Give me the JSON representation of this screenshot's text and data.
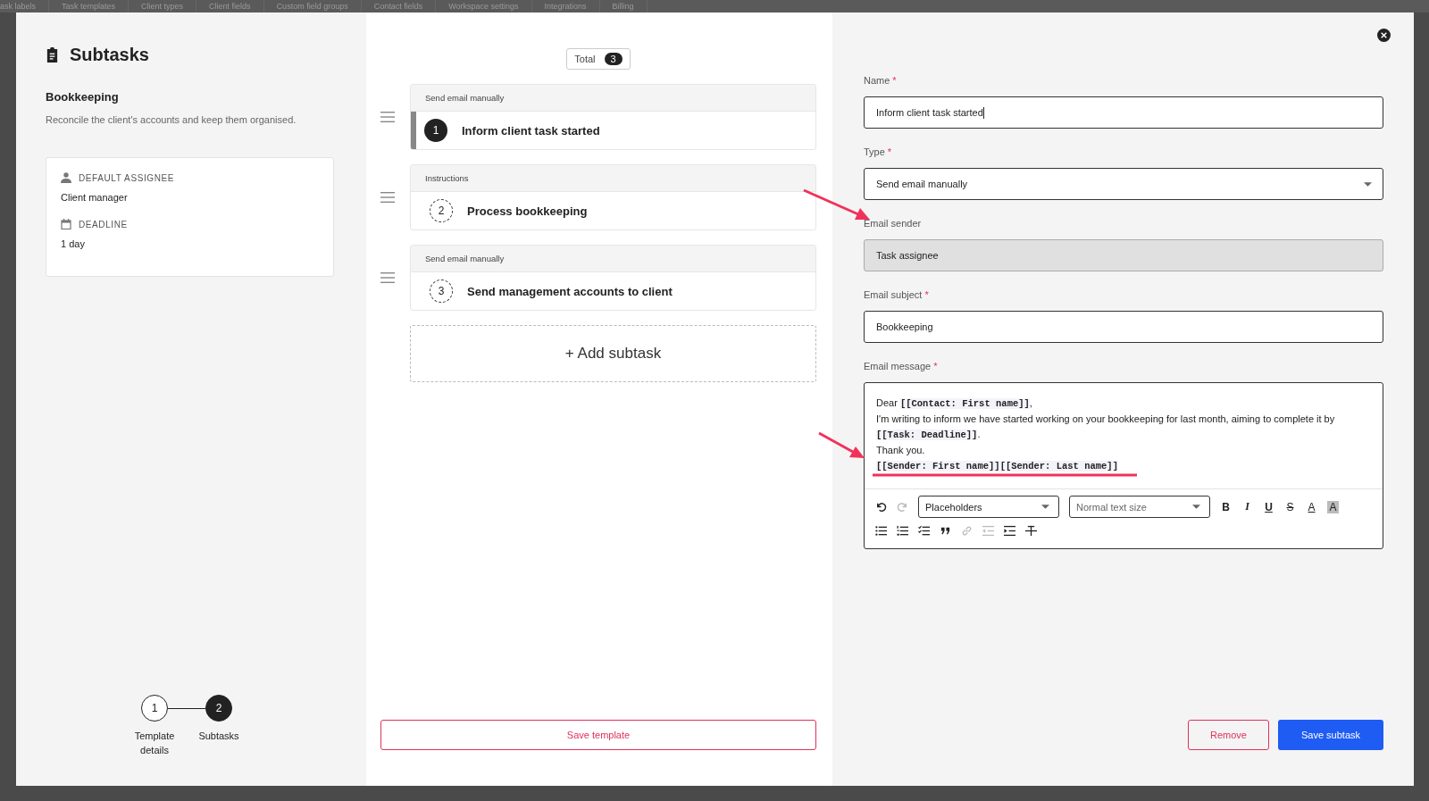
{
  "background_tabs": [
    "ask labels",
    "Task templates",
    "Client types",
    "Client fields",
    "Custom field groups",
    "Contact fields",
    "Workspace settings",
    "Integrations",
    "Billing"
  ],
  "left": {
    "title": "Subtasks",
    "template_name": "Bookkeeping",
    "template_description": "Reconcile the client's accounts and keep them organised.",
    "defaults": [
      {
        "kind": "assignee",
        "label": "DEFAULT ASSIGNEE",
        "value": "Client manager"
      },
      {
        "kind": "deadline",
        "label": "DEADLINE",
        "value": "1 day"
      }
    ],
    "steps": [
      {
        "number": "1",
        "label": "Template details",
        "selected": false
      },
      {
        "number": "2",
        "label": "Subtasks",
        "selected": true
      }
    ]
  },
  "middle": {
    "total": {
      "label": "Total",
      "count": "3"
    },
    "subtasks": [
      {
        "type": "Send email manually",
        "number": "1",
        "name": "Inform client task started",
        "selected": true
      },
      {
        "type": "Instructions",
        "number": "2",
        "name": "Process bookkeeping",
        "selected": false
      },
      {
        "type": "Send email manually",
        "number": "3",
        "name": "Send management accounts to client",
        "selected": false
      }
    ],
    "add_button": "+ Add subtask",
    "save_button": "Save template"
  },
  "form": {
    "fields": [
      {
        "kind": "input",
        "label": "Name",
        "required_mark": "*",
        "value": "Inform client task started",
        "disabled": false
      },
      {
        "kind": "select",
        "label": "Type",
        "required_mark": "*",
        "value": "Send email manually",
        "disabled": false
      },
      {
        "kind": "input",
        "label": "Email sender",
        "value": "Task assignee",
        "disabled": true
      },
      {
        "kind": "input",
        "label": "Email subject",
        "required_mark": "*",
        "value": "Bookkeeping",
        "disabled": false
      }
    ],
    "message": {
      "label": "Email message",
      "required_mark": "*",
      "lines": [
        [
          {
            "kind": "text",
            "text": "Dear "
          },
          {
            "kind": "placeholder",
            "text": "[[Contact: First name]]"
          },
          {
            "kind": "text",
            "text": ","
          }
        ],
        [
          {
            "kind": "text",
            "text": "I'm writing to inform we have started working on your bookkeeping for last month, aiming to complete it by"
          }
        ],
        [
          {
            "kind": "placeholder",
            "text": "[[Task: Deadline]]"
          },
          {
            "kind": "text",
            "text": "."
          }
        ],
        [
          {
            "kind": "text",
            "text": "Thank you."
          }
        ],
        [
          {
            "kind": "placeholder",
            "text": "[[Sender: First name]]"
          },
          {
            "kind": "placeholder",
            "text": "[[Sender: Last name]]"
          }
        ]
      ],
      "dropdowns": [
        "Placeholders",
        "Normal text size"
      ],
      "row1": [
        {
          "kind": "undo",
          "disabled": false
        },
        {
          "kind": "redo",
          "disabled": true
        }
      ],
      "row1b": [
        {
          "kind": "bold",
          "label": "B",
          "disabled": false
        },
        {
          "kind": "italic",
          "label": "I",
          "disabled": false
        },
        {
          "kind": "underline",
          "label": "U",
          "disabled": false
        },
        {
          "kind": "strike",
          "label": "S",
          "disabled": false
        },
        {
          "kind": "color",
          "label": "A",
          "disabled": false
        },
        {
          "kind": "highlight",
          "label": "A",
          "disabled": false
        }
      ],
      "row2": [
        {
          "kind": "bullets",
          "disabled": false
        },
        {
          "kind": "numbers",
          "disabled": false
        },
        {
          "kind": "checklist",
          "disabled": false
        },
        {
          "kind": "quote",
          "disabled": false
        },
        {
          "kind": "link",
          "disabled": true
        },
        {
          "kind": "outdent",
          "disabled": true
        },
        {
          "kind": "indent",
          "disabled": false
        },
        {
          "kind": "clear",
          "disabled": false
        }
      ]
    },
    "buttons": [
      {
        "kind": "secondary",
        "label": "Remove"
      },
      {
        "kind": "primary",
        "label": "Save subtask"
      }
    ]
  }
}
